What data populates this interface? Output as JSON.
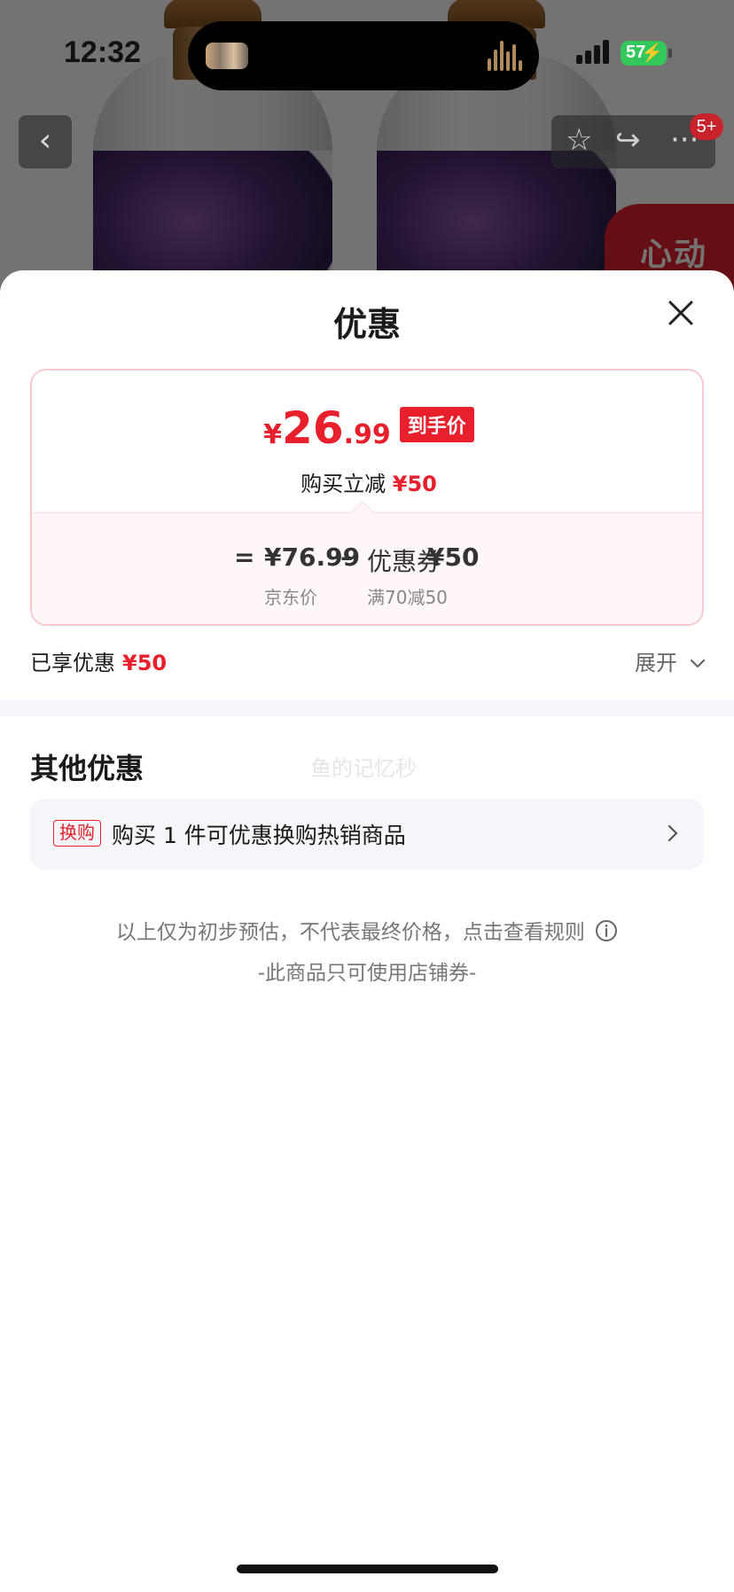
{
  "status_bar": {
    "time": "12:32",
    "battery": "57"
  },
  "background": {
    "promo_text": "心动",
    "badge": "5+"
  },
  "sheet": {
    "title": "优惠",
    "price": {
      "currency": "¥",
      "integer": "26",
      "decimal": ".99",
      "tag": "到手价"
    },
    "instant_reduce": {
      "label": "购买立减",
      "amount": "¥50"
    },
    "calc": {
      "equals": "=",
      "jd_price": "¥76.99",
      "minus": "–",
      "coupon_label": "优惠券",
      "coupon_amount": "¥50",
      "jd_price_label": "京东价",
      "coupon_rule": "满70减50"
    },
    "enjoyed": {
      "label": "已享优惠",
      "amount": "¥50"
    },
    "expand_label": "展开",
    "other": {
      "title": "其他优惠",
      "watermark": "鱼的记忆秒",
      "offer": {
        "tag": "换购",
        "text": "购买 1 件可优惠换购热销商品"
      }
    },
    "disclaimer": "以上仅为初步预估，不代表最终价格，点击查看规则",
    "shop_only": "-此商品只可使用店铺券-"
  },
  "colors": {
    "accent": "#e8202c",
    "battery": "#34c759",
    "panel": "#f5f6fa"
  }
}
